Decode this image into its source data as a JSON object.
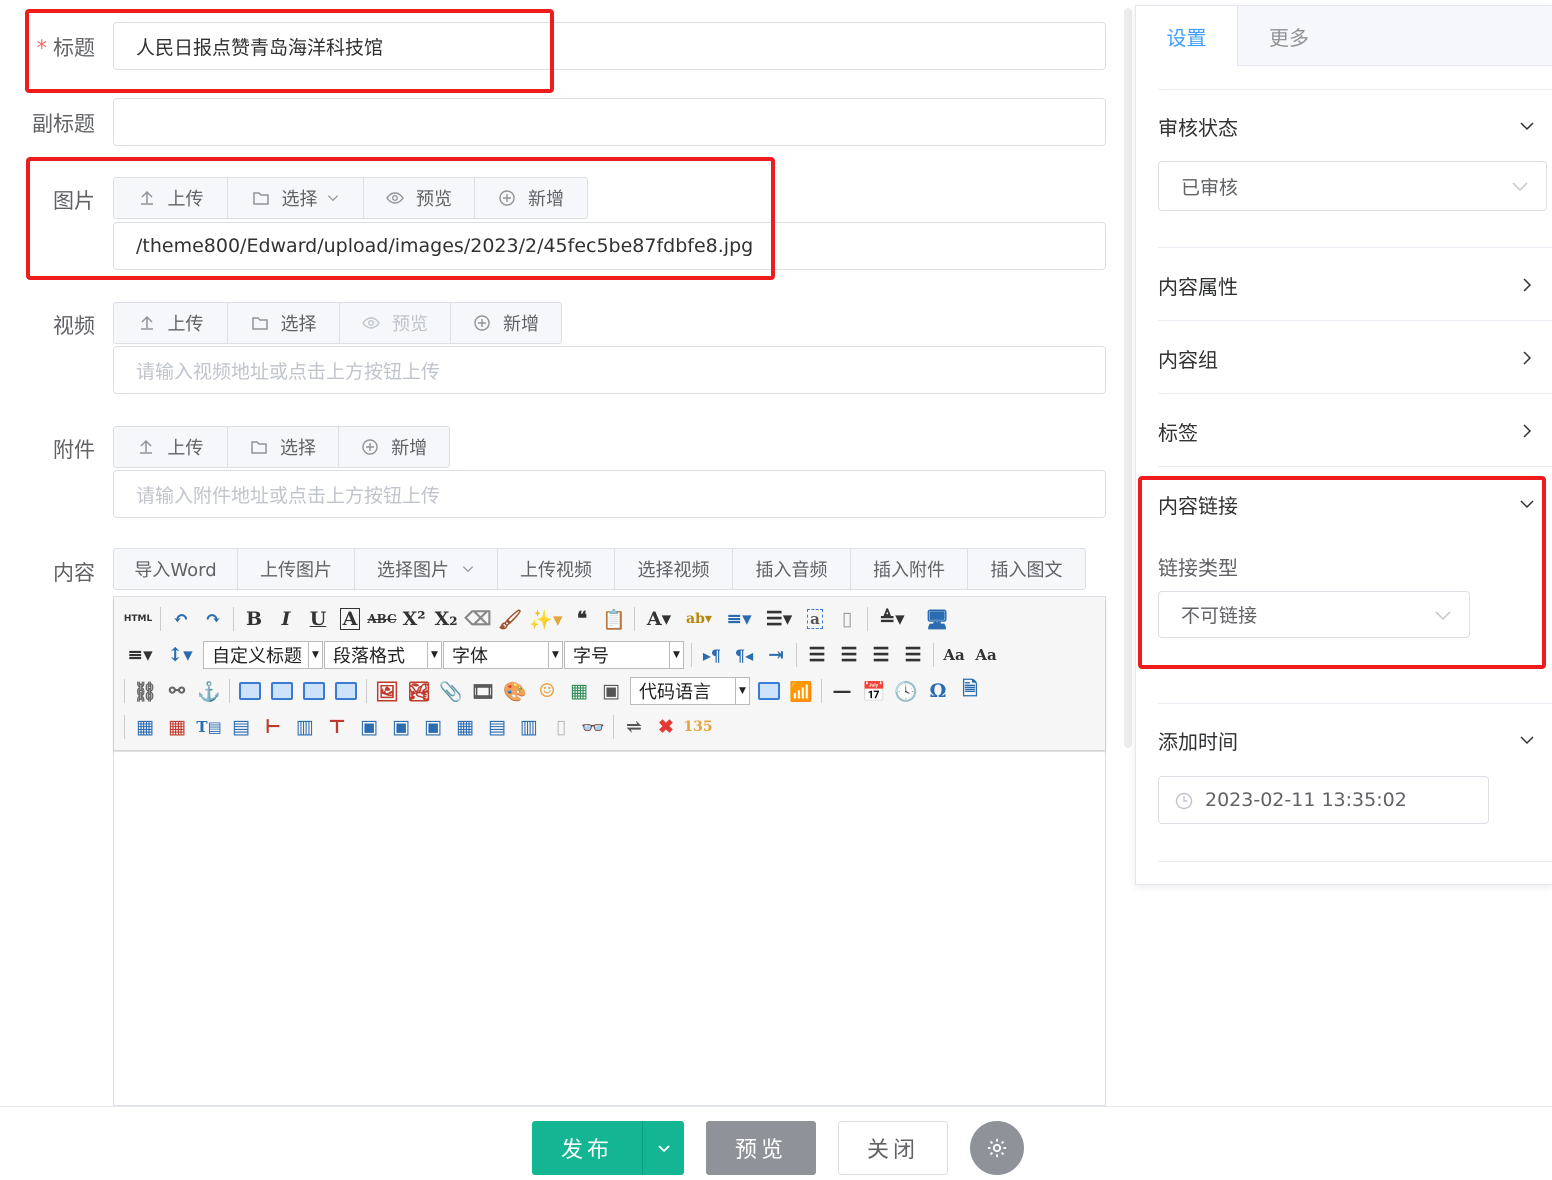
{
  "form": {
    "title": {
      "label": "标题",
      "required_mark": "*",
      "value": "人民日报点赞青岛海洋科技馆"
    },
    "subtitle": {
      "label": "副标题",
      "value": ""
    },
    "image": {
      "label": "图片",
      "buttons": {
        "upload": "上传",
        "choose": "选择",
        "preview": "预览",
        "add": "新增"
      },
      "value": "/theme800/Edward/upload/images/2023/2/45fec5be87fdbfe8.jpg"
    },
    "video": {
      "label": "视频",
      "buttons": {
        "upload": "上传",
        "choose": "选择",
        "preview": "预览",
        "add": "新增"
      },
      "placeholder": "请输入视频地址或点击上方按钮上传"
    },
    "attachment": {
      "label": "附件",
      "buttons": {
        "upload": "上传",
        "choose": "选择",
        "add": "新增"
      },
      "placeholder": "请输入附件地址或点击上方按钮上传"
    },
    "content": {
      "label": "内容",
      "buttons": [
        "导入Word",
        "上传图片",
        "选择图片",
        "上传视频",
        "选择视频",
        "插入音频",
        "插入附件",
        "插入图文"
      ]
    }
  },
  "editor": {
    "html_label": "HTML",
    "selects": {
      "custom_title": "自定义标题",
      "paragraph": "段落格式",
      "font": "字体",
      "size": "字号",
      "code_lang": "代码语言"
    }
  },
  "sidebar": {
    "tabs": {
      "settings": "设置",
      "more": "更多"
    },
    "review": {
      "title": "审核状态",
      "value": "已审核"
    },
    "attributes": {
      "title": "内容属性"
    },
    "group": {
      "title": "内容组"
    },
    "tags": {
      "title": "标签"
    },
    "link": {
      "title": "内容链接",
      "type_label": "链接类型",
      "type_value": "不可链接"
    },
    "time": {
      "title": "添加时间",
      "value": "2023-02-11 13:35:02"
    }
  },
  "footer": {
    "publish": "发布",
    "preview": "预览",
    "close": "关闭"
  },
  "colors": {
    "primary": "#13b593",
    "accent_blue": "#409eff",
    "highlight": "#ee1c1c",
    "gray_btn": "#8f9399"
  }
}
